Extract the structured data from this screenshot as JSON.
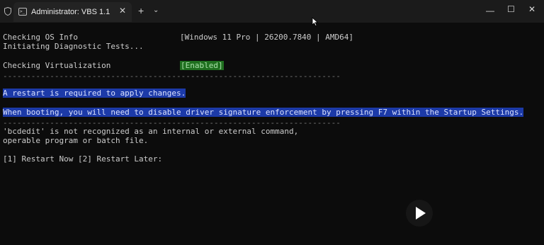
{
  "window": {
    "tab_title": "Administrator:  VBS 1.1",
    "tab_close": "✕",
    "new_tab": "+",
    "dropdown": "⌄",
    "minimize": "—",
    "maximize": "☐",
    "close": "✕"
  },
  "console": {
    "os_label": "Checking OS Info",
    "os_value": "[Windows 11 Pro | 26200.7840 | AMD64]",
    "diag": "Initiating Diagnostic Tests...",
    "virt_label": "Checking Virtualization",
    "virt_value": "[Enabled]",
    "separator": "------------------------------------------------------------------------",
    "restart_msg": "A restart is required to apply changes.",
    "boot_msg": "When booting, you will need to disable driver signature enforcement by pressing F7 within the Startup Settings.",
    "separator2": "------------------------------------------------------------------------",
    "error_line1": "'bcdedit' is not recognized as an internal or external command,",
    "error_line2": "operable program or batch file.",
    "prompt": "[1] Restart Now [2] Restart Later:"
  },
  "colors": {
    "enabled_bg": "#1f6f1f",
    "highlight_bg": "#1c3aa8"
  },
  "icons": {
    "shield": "shield-icon",
    "terminal": "terminal-icon",
    "play": "play-icon",
    "cursor": "mouse-cursor-icon"
  }
}
